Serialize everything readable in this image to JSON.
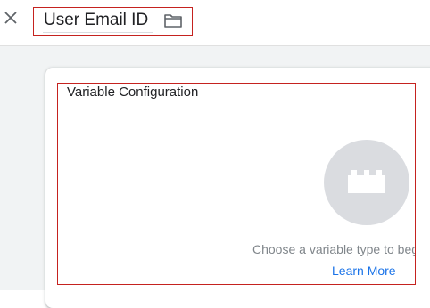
{
  "header": {
    "title": "User Email ID",
    "close_icon": "close-icon",
    "folder_icon": "folder-icon"
  },
  "variable_configuration": {
    "title": "Variable Configuration",
    "placeholder_icon": "variable-block-icon",
    "prompt": "Choose a variable type to begin",
    "learn_more_label": "Learn More"
  },
  "colors": {
    "accent_link": "#1a73e8",
    "highlight_border": "#c5221f",
    "page_background": "#f1f3f4",
    "icon_circle": "#dadce0"
  }
}
